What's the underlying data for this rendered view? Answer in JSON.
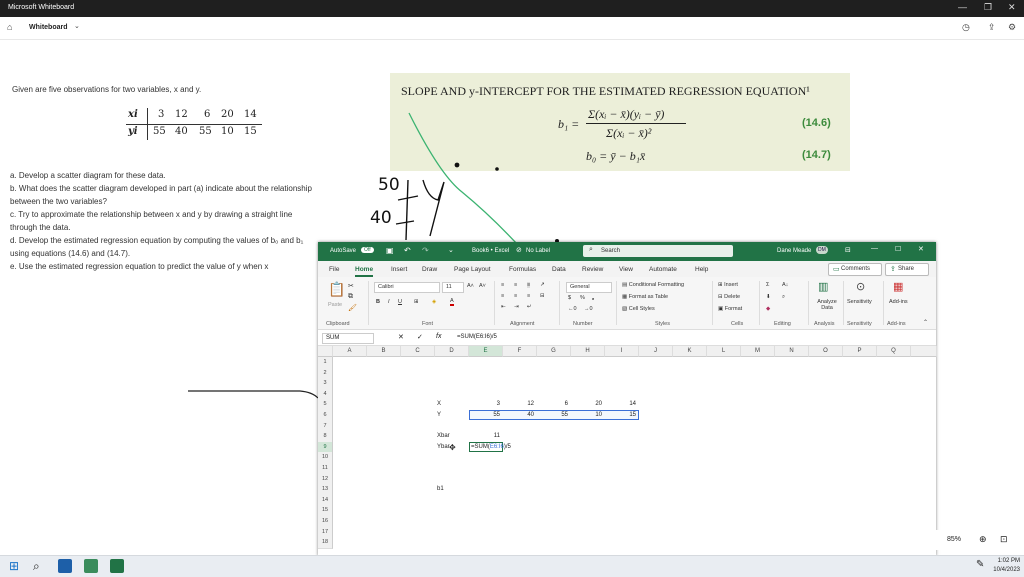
{
  "whiteboard": {
    "app_title": "Microsoft Whiteboard",
    "board_name": "Whiteboard",
    "zoom": "85%"
  },
  "problem": {
    "intro": "Given are five observations for two variables, x and y.",
    "x_label": "xi",
    "y_label": "yi",
    "x_values": [
      "3",
      "12",
      "6",
      "20",
      "14"
    ],
    "y_values": [
      "55",
      "40",
      "55",
      "10",
      "15"
    ],
    "parts": [
      "a. Develop a scatter diagram for these data.",
      "b. What does the scatter diagram developed in part (a) indicate about the relationship",
      "between the two variables?",
      "c. Try to approximate the relationship between x and y by drawing a straight line",
      "through the data.",
      "d. Develop the estimated regression equation by computing the values of b₀ and b₁",
      "using equations (14.6) and (14.7).",
      "e. Use the estimated regression equation to predict the value of y when x"
    ]
  },
  "textbook": {
    "heading": "SLOPE AND y-INTERCEPT FOR THE ESTIMATED REGRESSION EQUATION¹",
    "eq1_lhs": "b₁ =",
    "eq1_num": "Σ(xᵢ − x̄)(yᵢ − ȳ)",
    "eq1_den": "Σ(xᵢ − x̄)²",
    "eq1_num_label": "(14.6)",
    "eq2": "b₀ = ȳ − b₁x̄",
    "eq2_num_label": "(14.7)"
  },
  "handwriting": {
    "a": "50",
    "b": "40"
  },
  "excel": {
    "autosave": "AutoSave",
    "autosave_state": "Off",
    "book": "Book6 • Excel",
    "label": "No Label",
    "search_placeholder": "Search",
    "user": "Dane Meade",
    "initials": "DM",
    "tabs": [
      "File",
      "Home",
      "Insert",
      "Draw",
      "Page Layout",
      "Formulas",
      "Data",
      "Review",
      "View",
      "Automate",
      "Help"
    ],
    "comments": "Comments",
    "share": "Share",
    "font_name": "Calibri",
    "font_size": "11",
    "number_format": "General",
    "ribbon": {
      "paste": "Paste",
      "clipboard": "Clipboard",
      "font": "Font",
      "alignment": "Alignment",
      "number": "Number",
      "styles": "Styles",
      "cells": "Cells",
      "editing": "Editing",
      "analysis": "Analysis",
      "sensitivity": "Sensitivity",
      "addins": "Add-ins",
      "cond_format": "Conditional Formatting",
      "format_table": "Format as Table",
      "cell_styles": "Cell Styles",
      "insert": "Insert",
      "delete": "Delete",
      "format": "Format",
      "analyze_data": "Analyze Data",
      "sensitivity_btn": "Sensitivity",
      "addins_btn": "Add-ins"
    },
    "name_box": "SUM",
    "formula": "=SUM(E6:I6)/5",
    "columns": [
      "A",
      "B",
      "C",
      "D",
      "E",
      "F",
      "G",
      "H",
      "I",
      "J",
      "K",
      "L",
      "M",
      "N",
      "O",
      "P",
      "Q"
    ],
    "rows": [
      "1",
      "2",
      "3",
      "4",
      "5",
      "6",
      "7",
      "8",
      "9",
      "10",
      "11",
      "12",
      "13",
      "14",
      "15",
      "16",
      "17",
      "18"
    ],
    "cells": {
      "d5": "X",
      "e5": "3",
      "f5": "12",
      "g5": "6",
      "h5": "20",
      "i5": "14",
      "d6": "Y",
      "e6": "55",
      "f6": "40",
      "g6": "55",
      "h6": "10",
      "i6": "15",
      "d8": "Xbar",
      "e8": "11",
      "d9": "Ybar",
      "e9_a": "=SUM(",
      "e9_b": "E6:I6",
      "e9_c": ")/5",
      "d13": "b1"
    }
  },
  "taskbar": {
    "time": "1:02 PM",
    "date": "10/4/2023"
  }
}
